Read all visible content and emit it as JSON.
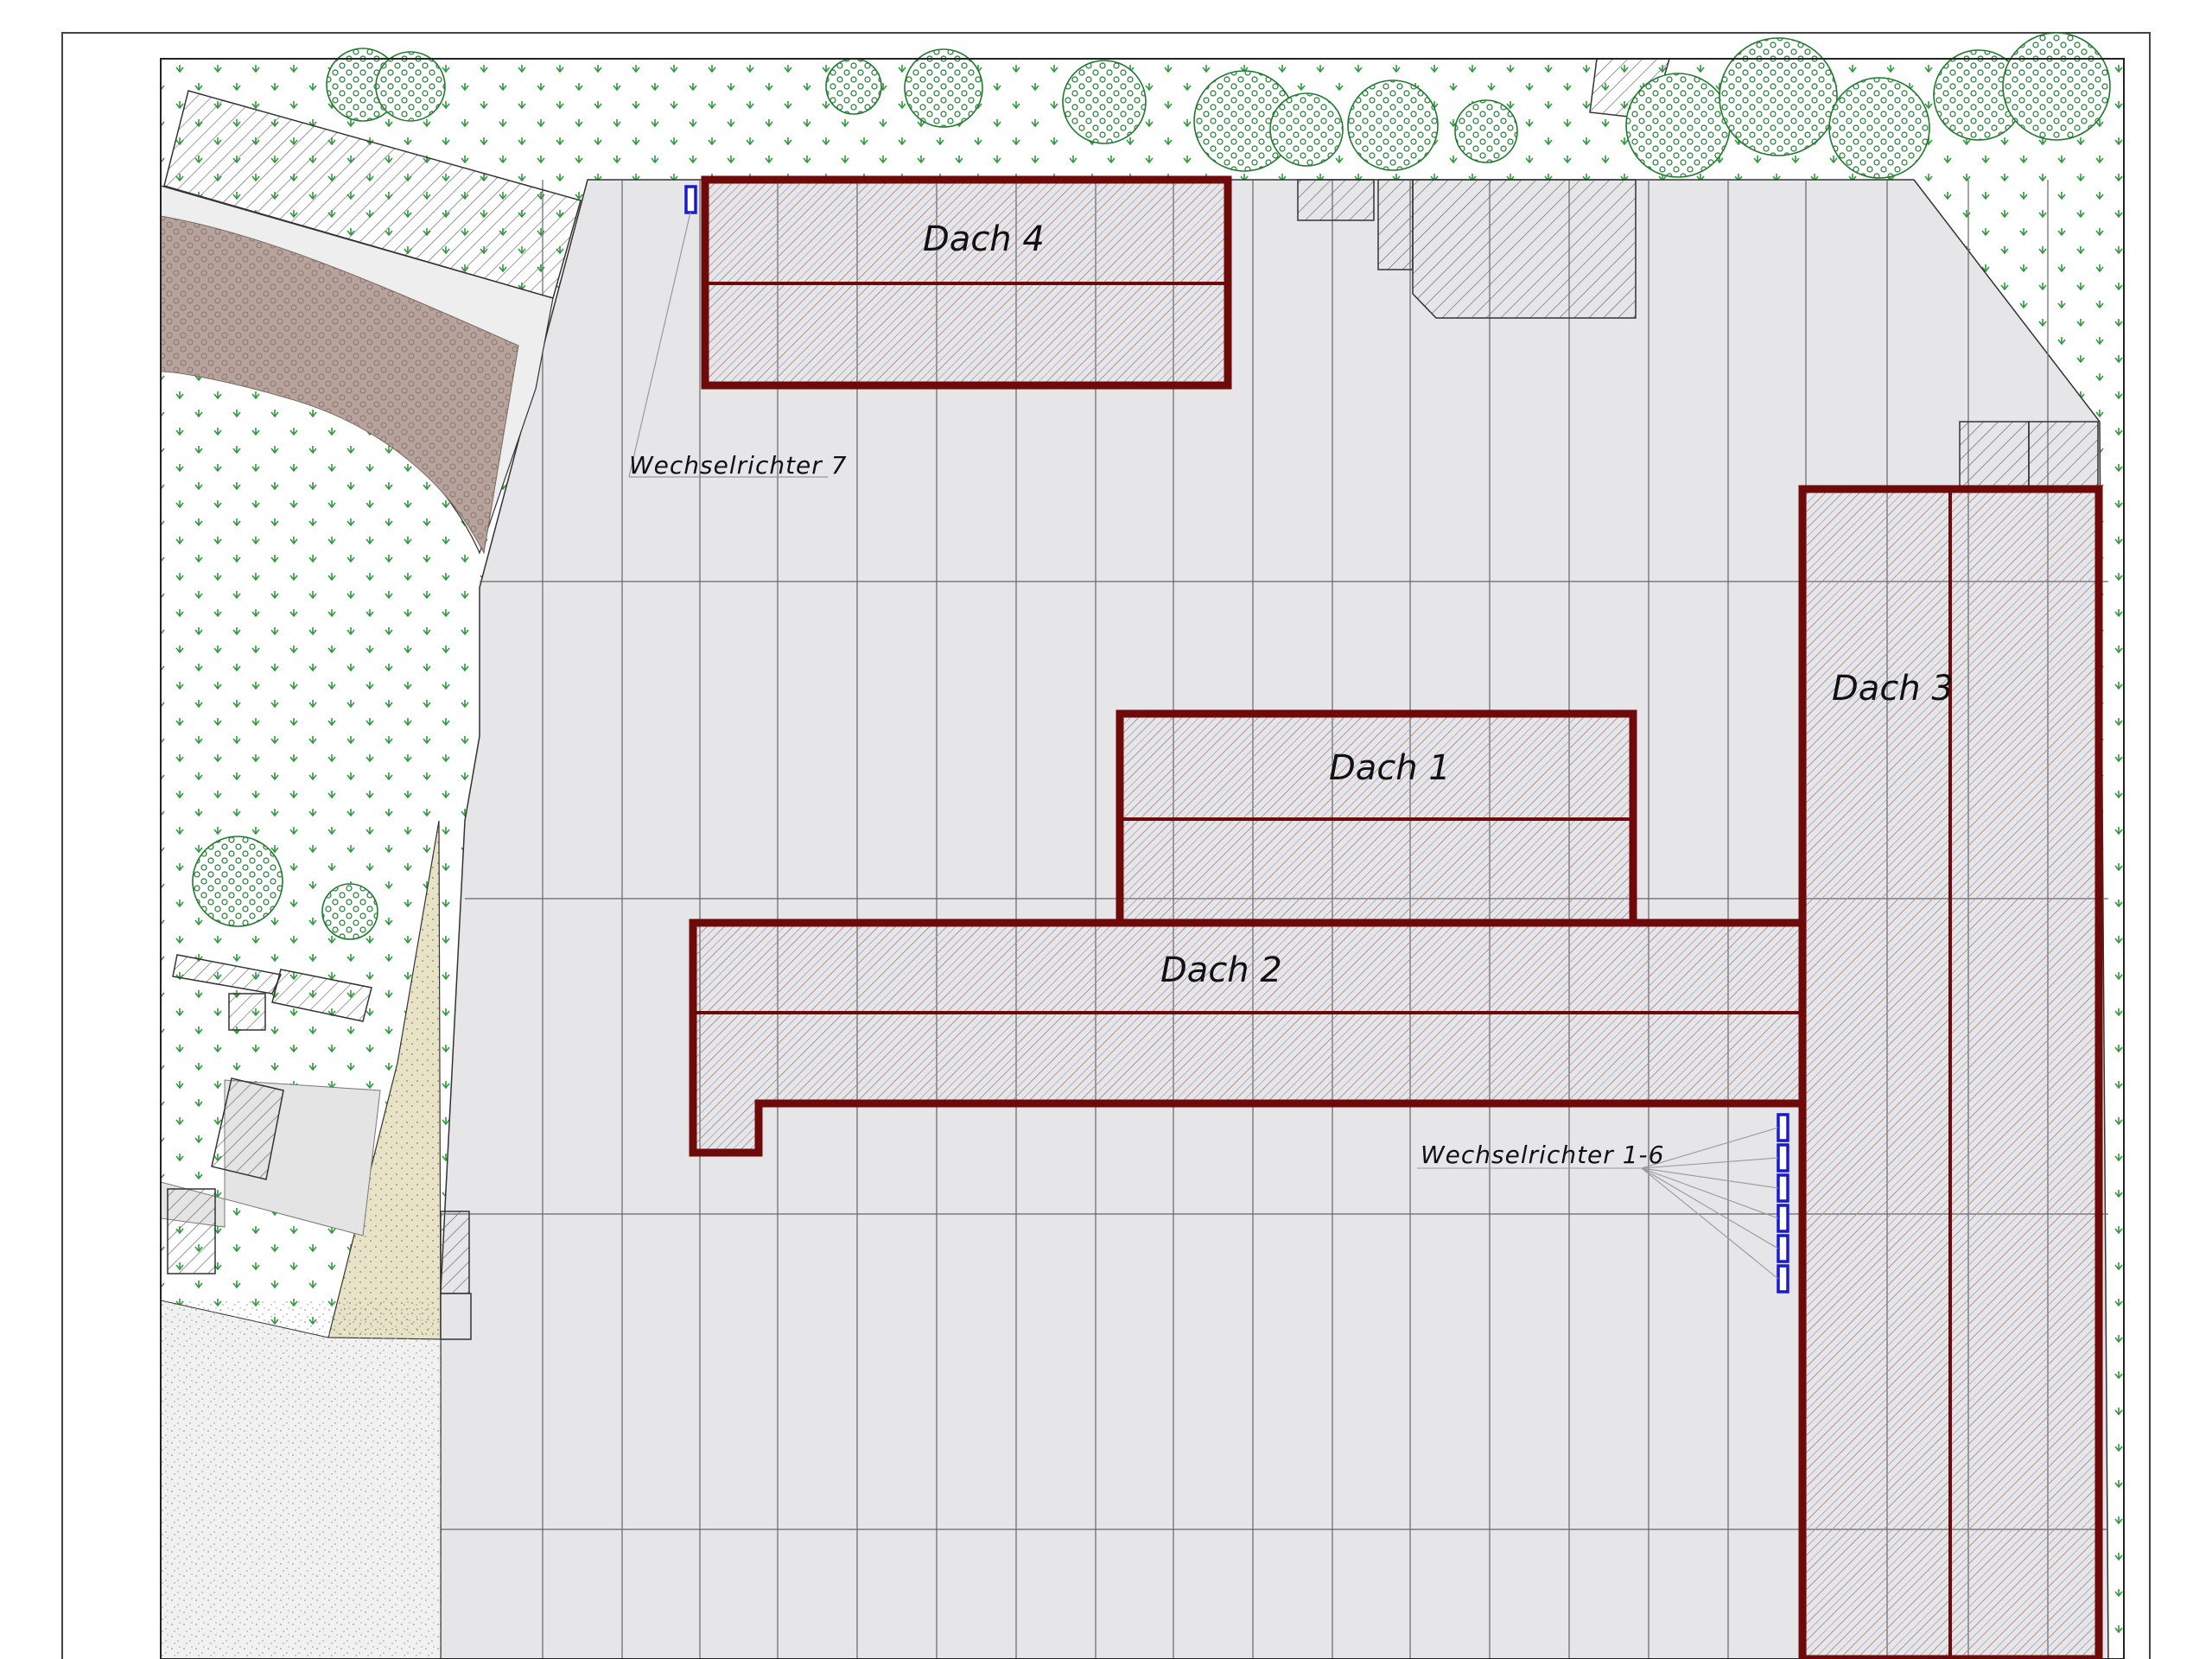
{
  "plan": {
    "roofs": [
      {
        "id": "dach-1",
        "label": "Dach 1"
      },
      {
        "id": "dach-2",
        "label": "Dach 2"
      },
      {
        "id": "dach-3",
        "label": "Dach 3"
      },
      {
        "id": "dach-4",
        "label": "Dach 4"
      }
    ],
    "inverters": [
      {
        "id": "inverter-group-1-6",
        "label": "Wechselrichter 1-6",
        "count": 6
      },
      {
        "id": "inverter-7",
        "label": "Wechselrichter 7",
        "count": 1
      }
    ]
  },
  "colors": {
    "roof_outline": "#6e0a0a",
    "inverter": "#1a1acc",
    "paving": "#e6e6e8",
    "grass_symbol": "#2e9a3a",
    "tree": "#1f7a2e",
    "hatch": "#555555"
  }
}
